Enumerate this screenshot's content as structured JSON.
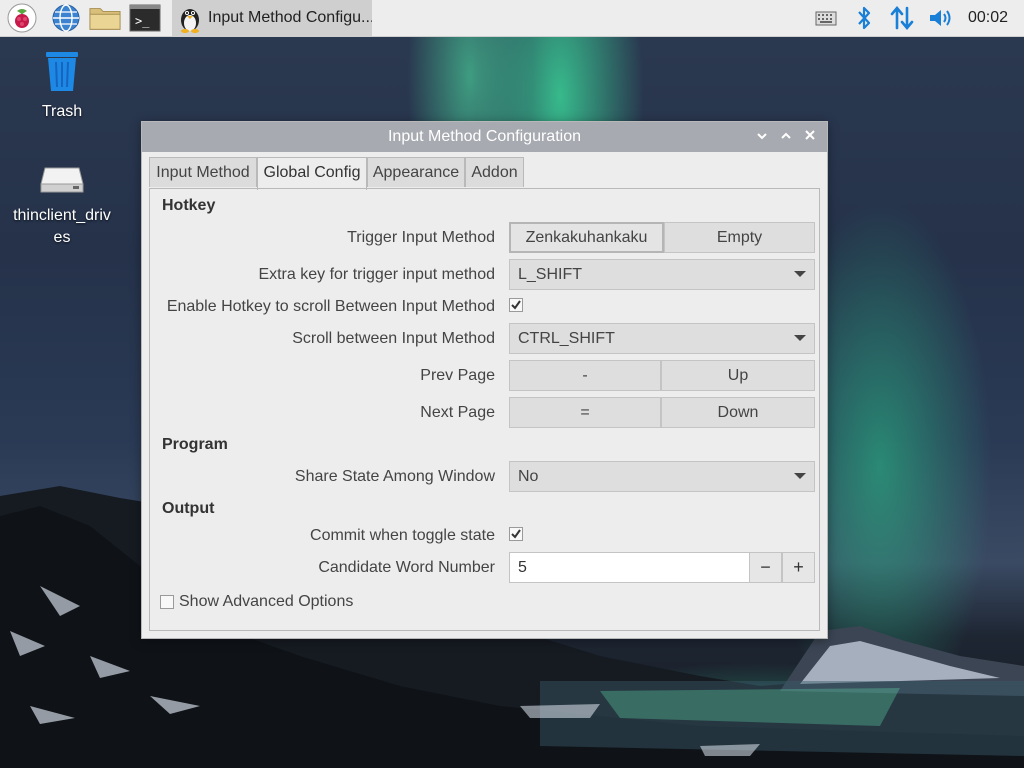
{
  "taskbar": {
    "task_title": "Input Method Configu...",
    "clock": "00:02",
    "icons": [
      "raspberry-menu-icon",
      "web-browser-icon",
      "file-manager-icon",
      "terminal-icon",
      "keyboard-icon",
      "bluetooth-icon",
      "network-icon",
      "volume-icon"
    ]
  },
  "desktop": {
    "icons": [
      {
        "label": "Trash",
        "icon": "trash-icon"
      },
      {
        "label": "thinclient_drives",
        "icon": "drive-icon"
      }
    ]
  },
  "window": {
    "title": "Input Method Configuration",
    "tabs": [
      "Input Method",
      "Global Config",
      "Appearance",
      "Addon"
    ],
    "active_tab": "Global Config",
    "sections": {
      "hotkey": "Hotkey",
      "program": "Program",
      "output": "Output"
    },
    "trigger_input_method": {
      "label": "Trigger Input Method",
      "key1": "Zenkakuhankaku",
      "key2": "Empty"
    },
    "extra_key": {
      "label": "Extra key for trigger input method",
      "value": "L_SHIFT"
    },
    "enable_hotkey_scroll": {
      "label": "Enable Hotkey to scroll Between Input Method",
      "checked": true
    },
    "scroll_between": {
      "label": "Scroll between Input Method",
      "value": "CTRL_SHIFT"
    },
    "prev_page": {
      "label": "Prev Page",
      "key1": "-",
      "key2": "Up"
    },
    "next_page": {
      "label": "Next Page",
      "key1": "=",
      "key2": "Down"
    },
    "share_state": {
      "label": "Share State Among Window",
      "value": "No"
    },
    "commit_toggle": {
      "label": "Commit when toggle state",
      "checked": true
    },
    "candidate_word_number": {
      "label": "Candidate Word Number",
      "value": "5",
      "minus": "−",
      "plus": "+"
    },
    "show_advanced": {
      "label": "Show Advanced Options",
      "checked": false
    }
  }
}
